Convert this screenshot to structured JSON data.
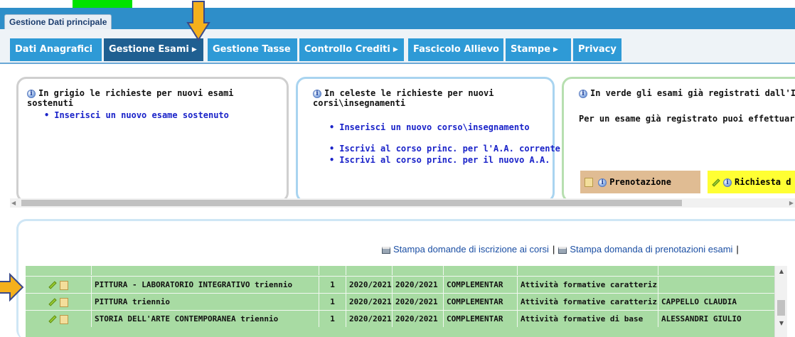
{
  "main_tab": {
    "label": "Gestione Dati principale"
  },
  "nav": [
    {
      "label": "Dati Anagrafici",
      "has_submenu": false,
      "active": false
    },
    {
      "label": "Gestione Esami",
      "has_submenu": true,
      "active": true
    },
    {
      "label": "Gestione Tasse",
      "has_submenu": false,
      "active": false
    },
    {
      "label": "Controllo Crediti",
      "has_submenu": true,
      "active": false
    },
    {
      "label": "Fascicolo Allievo",
      "has_submenu": false,
      "active": false
    },
    {
      "label": "Stampe",
      "has_submenu": true,
      "active": false
    },
    {
      "label": "Privacy",
      "has_submenu": false,
      "active": false
    }
  ],
  "grey_box": {
    "heading": "In grigio le richieste per nuovi esami sostenuti",
    "link": "Inserisci un nuovo esame sostenuto"
  },
  "blue_box": {
    "heading": "In celeste le richieste per nuovi corsi\\insegnamenti",
    "links": [
      "Inserisci un nuovo corso\\insegnamento",
      "Iscrivi al corso princ. per l'A.A. corrente",
      "Iscrivi al corso princ. per il nuovo A.A."
    ]
  },
  "green_box": {
    "heading": "In verde gli esami già registrati dall'Istitu",
    "subtext": "Per un esame già registrato puoi effettuare u",
    "prenotazione_label": "Prenotazione",
    "richiesta_label": "Richiesta d"
  },
  "print_links": {
    "iscrizione": "Stampa domande di iscrizione ai corsi",
    "separator": "|",
    "prenotazioni": "Stampa domanda di prenotazioni esami",
    "trailing": "|"
  },
  "exams": [
    {
      "name": "PITTURA - LABORATORIO INTEGRATIVO triennio",
      "num": "1",
      "year1": "2020/2021",
      "year2": "2020/2021",
      "type": "COMPLEMENTAR",
      "activity": "Attività formative caratterizzant",
      "teacher": ""
    },
    {
      "name": "PITTURA triennio",
      "num": "1",
      "year1": "2020/2021",
      "year2": "2020/2021",
      "type": "COMPLEMENTAR",
      "activity": "Attività formative caratterizzant",
      "teacher": "CAPPELLO CLAUDIA"
    },
    {
      "name": "STORIA DELL'ARTE CONTEMPORANEA triennio",
      "num": "1",
      "year1": "2020/2021",
      "year2": "2020/2021",
      "type": "COMPLEMENTAR",
      "activity": "Attività formative di base",
      "teacher": "ALESSANDRI GIULIO"
    }
  ],
  "colors": {
    "top_bar": "#2e8ec9",
    "nav_button": "#2e9ad6",
    "nav_active": "#1f5f91",
    "row_green": "#a8dba3",
    "annotation_arrow": "#f5b01c",
    "marker_green": "#00e300"
  }
}
